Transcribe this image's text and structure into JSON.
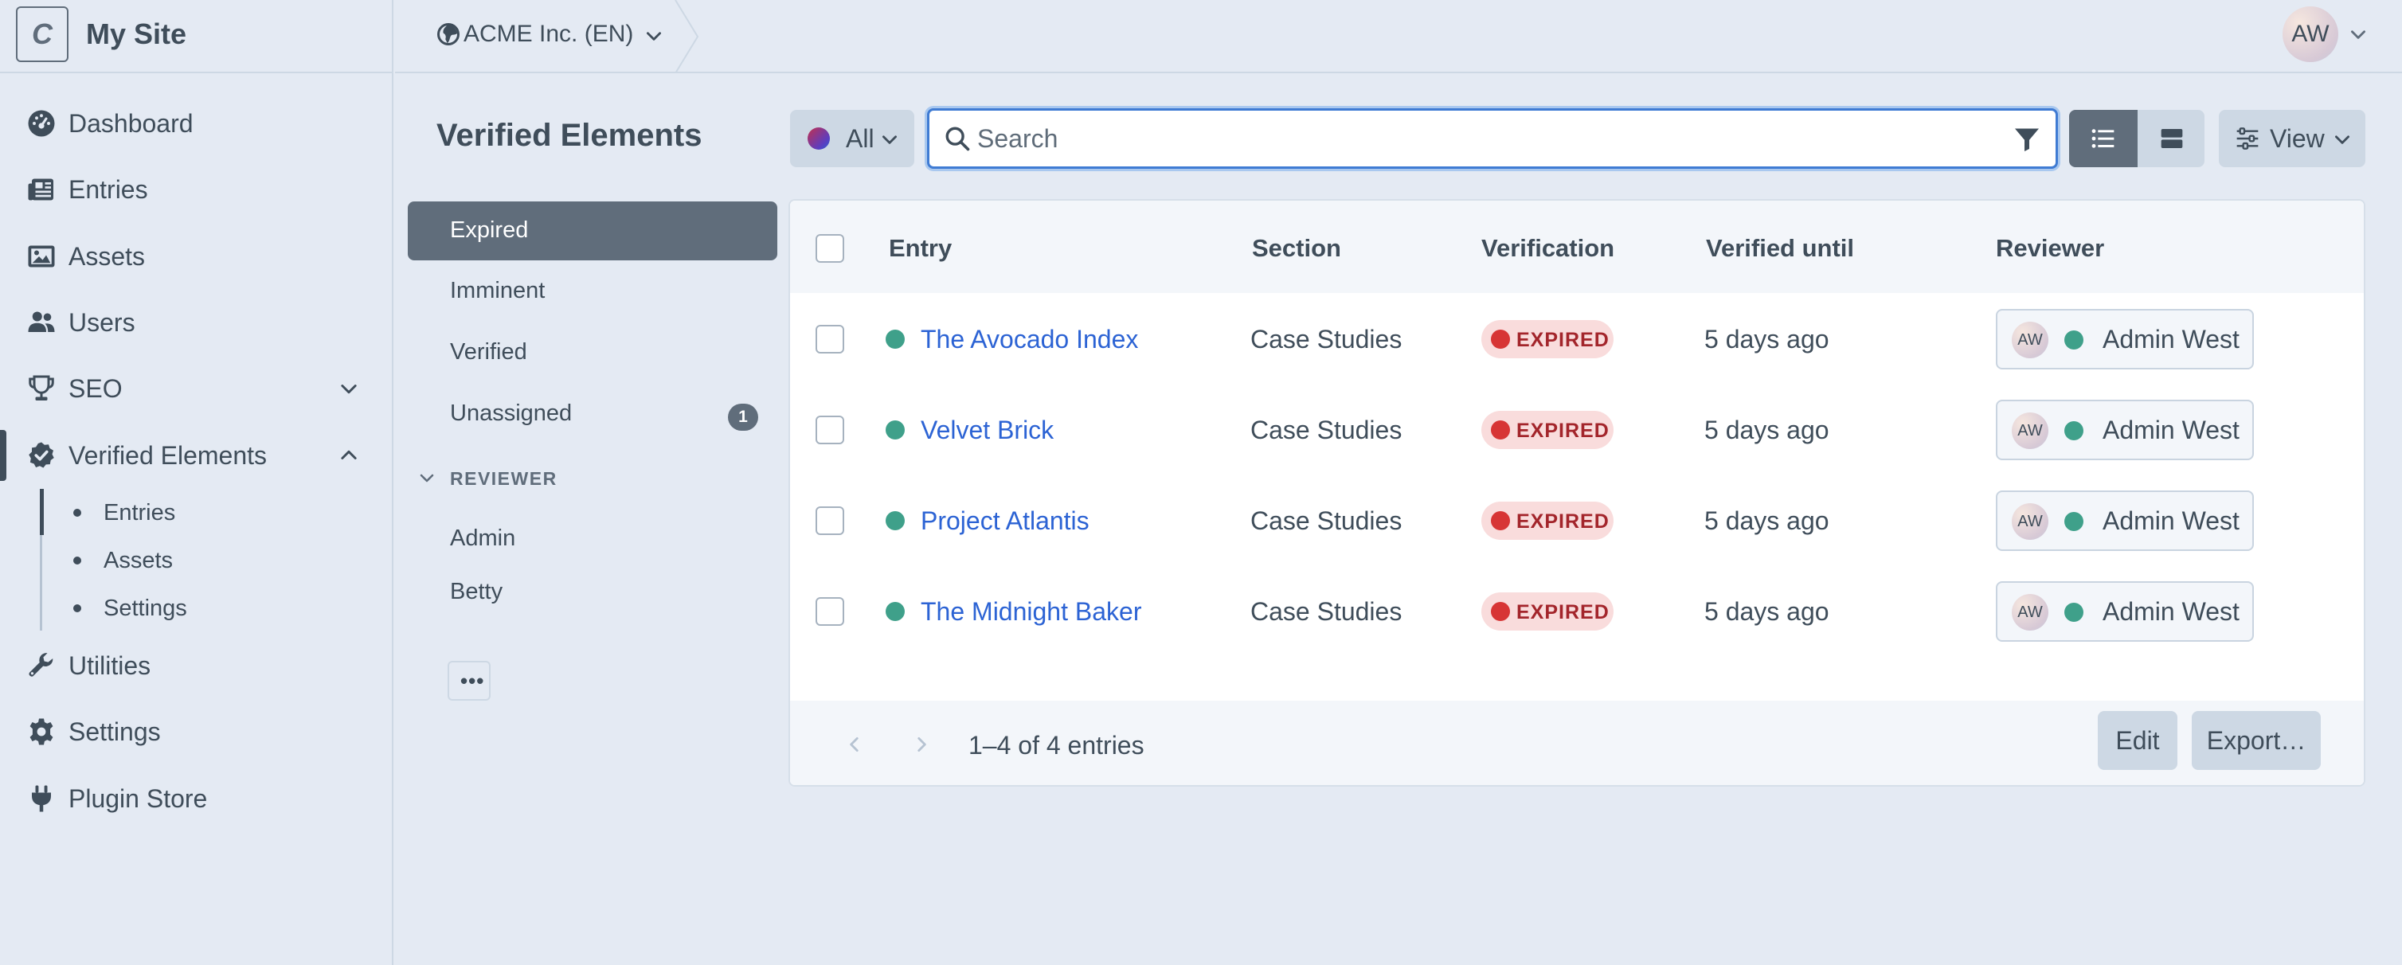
{
  "site": {
    "logo_letter": "C",
    "name": "My Site"
  },
  "nav": {
    "items": [
      {
        "label": "Dashboard",
        "icon": "gauge-icon"
      },
      {
        "label": "Entries",
        "icon": "newspaper-icon"
      },
      {
        "label": "Assets",
        "icon": "image-icon"
      },
      {
        "label": "Users",
        "icon": "users-icon"
      },
      {
        "label": "SEO",
        "icon": "trophy-icon"
      },
      {
        "label": "Verified Elements",
        "icon": "check-badge-icon"
      },
      {
        "label": "Utilities",
        "icon": "wrench-icon"
      },
      {
        "label": "Settings",
        "icon": "gear-icon"
      },
      {
        "label": "Plugin Store",
        "icon": "plug-icon"
      }
    ],
    "subitems": [
      "Entries",
      "Assets",
      "Settings"
    ]
  },
  "topbar": {
    "site_switch": "ACME Inc. (EN)",
    "user_initials": "AW"
  },
  "page": {
    "title": "Verified Elements"
  },
  "toolbar": {
    "site_filter": "All",
    "search_placeholder": "Search",
    "search_value": "",
    "view_label": "View"
  },
  "sources": {
    "items": [
      {
        "label": "Expired",
        "badge": ""
      },
      {
        "label": "Imminent",
        "badge": ""
      },
      {
        "label": "Verified",
        "badge": ""
      },
      {
        "label": "Unassigned",
        "badge": "1"
      }
    ],
    "heading": "REVIEWER",
    "reviewers": [
      "Admin",
      "Betty"
    ],
    "more": "•••"
  },
  "table": {
    "headers": [
      "Entry",
      "Section",
      "Verification",
      "Verified until",
      "Reviewer"
    ],
    "rows": [
      {
        "entry": "The Avocado Index",
        "section": "Case Studies",
        "verification": "EXPIRED",
        "until": "5 days ago",
        "reviewer_initials": "AW",
        "reviewer": "Admin West"
      },
      {
        "entry": "Velvet Brick",
        "section": "Case Studies",
        "verification": "EXPIRED",
        "until": "5 days ago",
        "reviewer_initials": "AW",
        "reviewer": "Admin West"
      },
      {
        "entry": "Project Atlantis",
        "section": "Case Studies",
        "verification": "EXPIRED",
        "until": "5 days ago",
        "reviewer_initials": "AW",
        "reviewer": "Admin West"
      },
      {
        "entry": "The Midnight Baker",
        "section": "Case Studies",
        "verification": "EXPIRED",
        "until": "5 days ago",
        "reviewer_initials": "AW",
        "reviewer": "Admin West"
      }
    ],
    "footer": {
      "count": "1–4 of 4 entries",
      "edit": "Edit",
      "export": "Export…"
    }
  },
  "colors": {
    "accent_link": "#2c63d4",
    "status_enabled": "#3fa08a",
    "expired_badge_bg": "#f9dcdc",
    "expired_badge_dot": "#d73535",
    "focus_ring": "#3f7bd3"
  }
}
